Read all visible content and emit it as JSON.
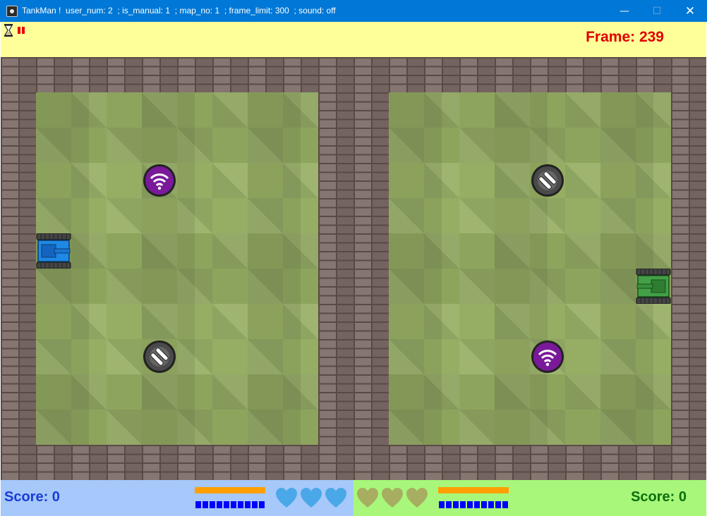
{
  "window": {
    "title": "TankMan !  user_num: 2  ; is_manual: 1  ; map_no: 1  ; frame_limit: 300  ; sound: off",
    "minimize_glyph": "—",
    "maximize_glyph": "☐",
    "close_glyph": "✕"
  },
  "top_hud": {
    "frame_text": "Frame: 239",
    "frame_color": "#e00000",
    "icons": [
      "hourglass-icon",
      "pause-icon"
    ]
  },
  "playfield": {
    "halves": 2,
    "tiles": [
      "brick-wall",
      "grass"
    ],
    "stations": [
      {
        "name": "oil-station-icon",
        "color": "#7a1a9a"
      },
      {
        "name": "bullet-station-icon",
        "color": "#4a4a4a"
      },
      {
        "name": "bullet-station-icon",
        "color": "#4a4a4a"
      },
      {
        "name": "oil-station-icon",
        "color": "#7a1a9a"
      }
    ],
    "tanks": [
      {
        "player": 1,
        "color": "#1e88e5",
        "facing": "right"
      },
      {
        "player": 2,
        "color": "#43a047",
        "facing": "left"
      }
    ]
  },
  "bottom_hud": {
    "player1": {
      "score_text": "Score: 0",
      "background": "#a6c8fa",
      "fuel_level": 1.0,
      "ammo": 10,
      "lives": 3,
      "heart_color": "#4aa8e8"
    },
    "player2": {
      "score_text": "Score: 0",
      "background": "#a8f77a",
      "fuel_level": 1.0,
      "ammo": 10,
      "lives": 3,
      "heart_color": "#a7ae62"
    }
  }
}
